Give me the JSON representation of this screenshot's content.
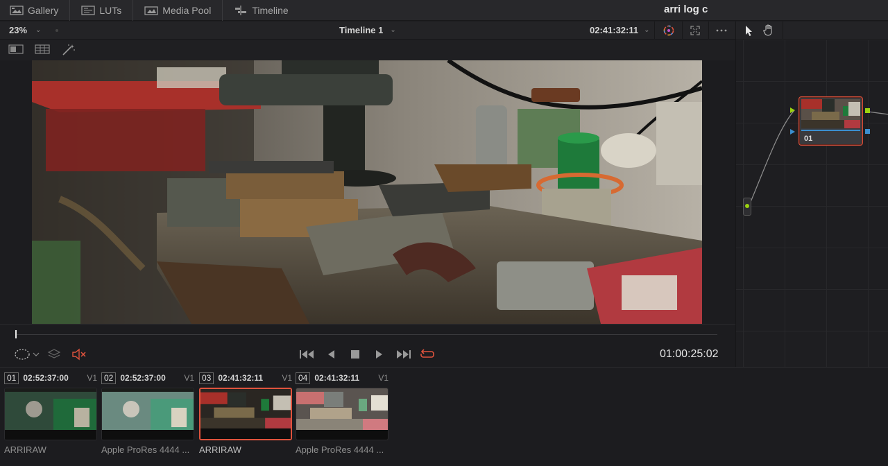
{
  "topbar": {
    "tabs": [
      {
        "label": "Gallery",
        "icon": "gallery-icon"
      },
      {
        "label": "LUTs",
        "icon": "luts-icon"
      },
      {
        "label": "Media Pool",
        "icon": "media-pool-icon"
      },
      {
        "label": "Timeline",
        "icon": "timeline-icon"
      }
    ],
    "project_title": "arri log c"
  },
  "viewer_header": {
    "zoom": "23%",
    "timeline_name": "Timeline 1",
    "source_timecode": "02:41:32:11"
  },
  "transport": {
    "timecode": "01:00:25:02",
    "playhead_fraction": 0.0
  },
  "node_editor": {
    "node_label": "01"
  },
  "clips": [
    {
      "num": "01",
      "timecode": "02:52:37:00",
      "track": "V1",
      "codec": "ARRIRAW",
      "selected": false
    },
    {
      "num": "02",
      "timecode": "02:52:37:00",
      "track": "V1",
      "codec": "Apple ProRes 4444 ...",
      "selected": false
    },
    {
      "num": "03",
      "timecode": "02:41:32:11",
      "track": "V1",
      "codec": "ARRIRAW",
      "selected": true
    },
    {
      "num": "04",
      "timecode": "02:41:32:11",
      "track": "V1",
      "codec": "Apple ProRes 4444 ...",
      "selected": false
    }
  ],
  "colors": {
    "accent_red": "#e0533d",
    "node_border": "#d94f3a",
    "node_green": "#9bd30f",
    "node_blue": "#3b8fd0"
  }
}
